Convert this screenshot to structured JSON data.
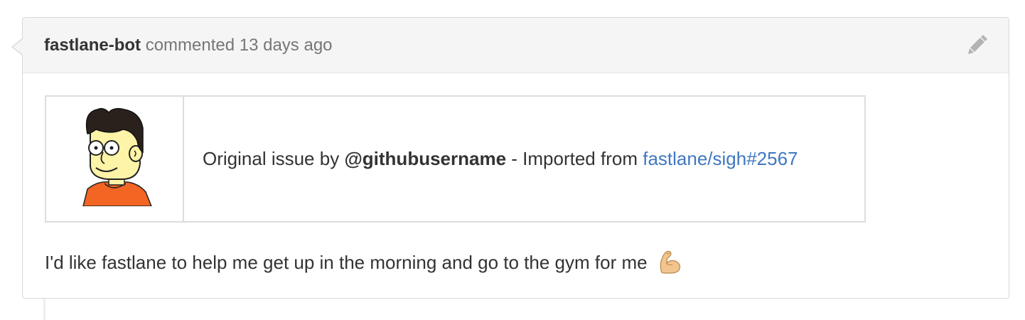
{
  "comment": {
    "author": "fastlane-bot",
    "action": "commented",
    "time": "13 days ago",
    "edit_icon": "pencil-icon"
  },
  "import_info": {
    "avatar_icon": "cartoon-avatar",
    "prefix": "Original issue by",
    "username": "@githubusername",
    "separator": "- Imported from",
    "issue_link": "fastlane/sigh#2567",
    "link_color": "#4078c0"
  },
  "body": {
    "text": "I'd like fastlane to help me get up in the morning and go to the gym for me",
    "emoji_icon": "flexed-biceps-icon"
  }
}
